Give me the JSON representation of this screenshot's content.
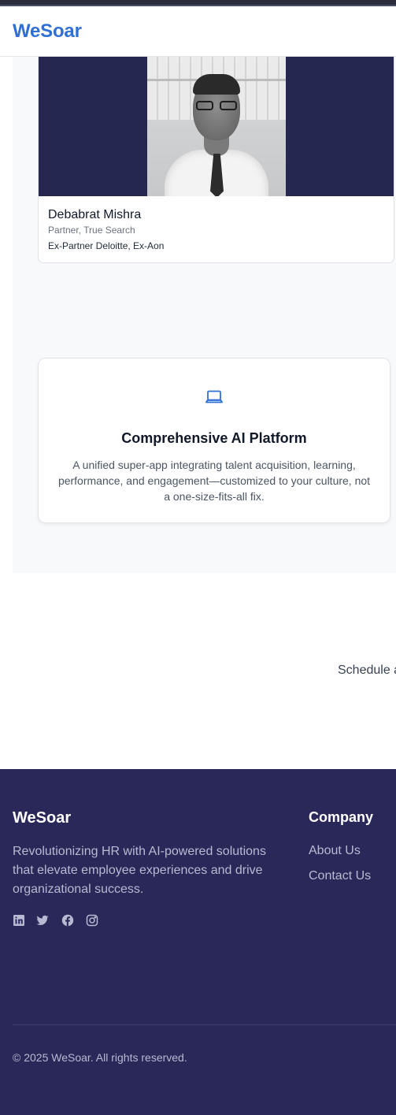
{
  "header": {
    "logo": "WeSoar"
  },
  "profile": {
    "name": "Debabrat Mishra",
    "role": "Partner, True Search",
    "experience": "Ex-Partner Deloitte, Ex-Aon"
  },
  "feature": {
    "icon": "laptop-icon",
    "title": "Comprehensive AI Platform",
    "description": "A unified super-app integrating talent acquisition, learning, performance, and engagement—customized to your culture, not a one-size-fits-all fix."
  },
  "cta": {
    "text": "Schedule a"
  },
  "footer": {
    "brand": "WeSoar",
    "tagline": "Revolutionizing HR with AI-powered solutions that elevate employee experiences and drive organizational success.",
    "social": [
      "linkedin-icon",
      "twitter-icon",
      "facebook-icon",
      "instagram-icon"
    ],
    "company_heading": "Company",
    "links": [
      "About Us",
      "Contact Us"
    ],
    "copyright": "© 2025 WeSoar. All rights reserved."
  },
  "colors": {
    "brand_blue": "#2f6fd6",
    "navy": "#262750",
    "footer_bg": "#2a2858",
    "footer_text": "#b8b9d2"
  }
}
